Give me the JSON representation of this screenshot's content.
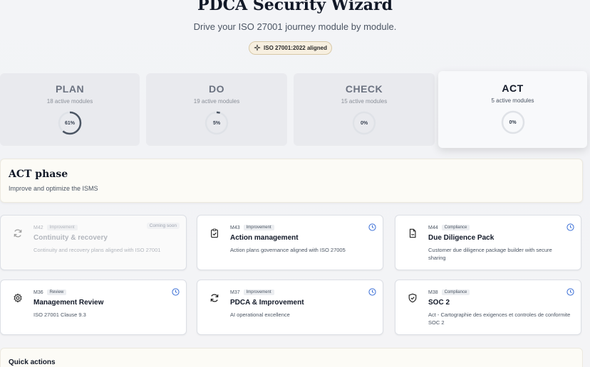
{
  "header": {
    "title": "PDCA Security Wizard",
    "subtitle": "Drive your ISO 27001 journey module by module.",
    "badge": "ISO 27001:2022 aligned"
  },
  "phases": [
    {
      "name": "PLAN",
      "count": "18 active modules",
      "progress_label": "61%",
      "progress": 0.61,
      "active": false
    },
    {
      "name": "DO",
      "count": "19 active modules",
      "progress_label": "5%",
      "progress": 0.05,
      "active": false
    },
    {
      "name": "CHECK",
      "count": "15 active modules",
      "progress_label": "0%",
      "progress": 0.0,
      "active": false
    },
    {
      "name": "ACT",
      "count": "5 active modules",
      "progress_label": "0%",
      "progress": 0.0,
      "active": true
    }
  ],
  "act_panel": {
    "title": "ACT phase",
    "description": "Improve and optimize the ISMS"
  },
  "modules": [
    {
      "code": "M42",
      "tag": "Improvement",
      "title": "Continuity & recovery",
      "description": "Continuity and recovery plans aligned with ISO 27001",
      "status": "Coming soon",
      "icon": "refresh-icon"
    },
    {
      "code": "M43",
      "tag": "Improvement",
      "title": "Action management",
      "description": "Action plans governance aligned with ISO 27005",
      "icon": "clipboard-check-icon"
    },
    {
      "code": "M44",
      "tag": "Compliance",
      "title": "Due Diligence Pack",
      "description": "Customer due diligence package builder with secure sharing",
      "icon": "document-sign-icon"
    },
    {
      "code": "M36",
      "tag": "Review",
      "title": "Management Review",
      "description": "ISO 27001 Clause 9.3",
      "icon": "gear-icon"
    },
    {
      "code": "M37",
      "tag": "Improvement",
      "title": "PDCA & Improvement",
      "description": "AI operational excellence",
      "icon": "refresh-icon"
    },
    {
      "code": "M38",
      "tag": "Compliance",
      "title": "SOC 2",
      "description": "Act - Cartographie des exigences et controles de conformite SOC 2",
      "icon": "shield-check-icon"
    }
  ],
  "quick_actions": {
    "title": "Quick actions"
  },
  "colors": {
    "accent": "#3b6fd6",
    "ring": "#4b5563",
    "ring_track": "#dfe2e7"
  }
}
